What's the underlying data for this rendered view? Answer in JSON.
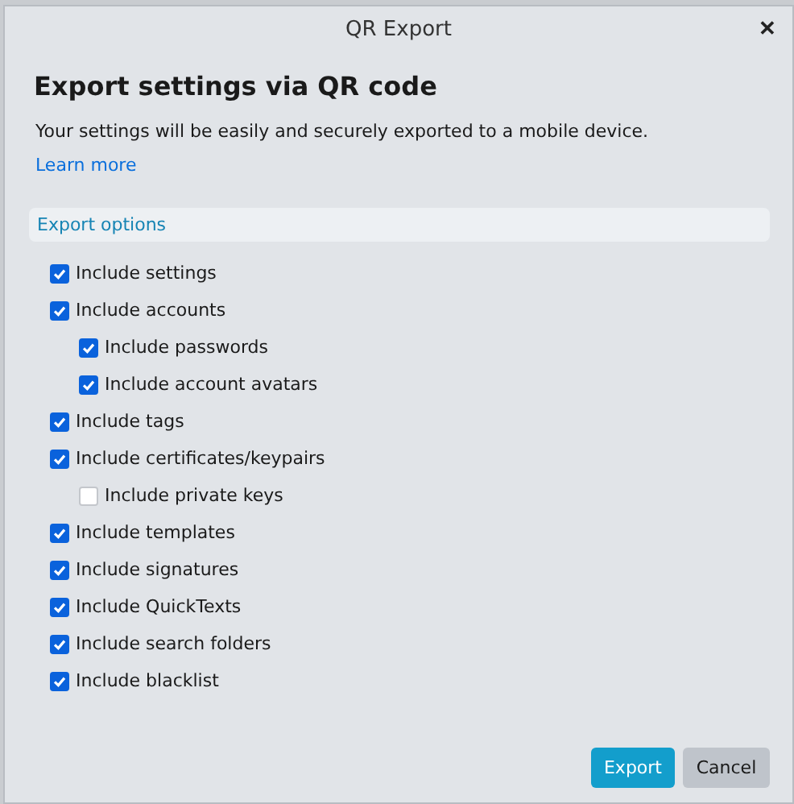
{
  "window": {
    "title": "QR Export",
    "close": "✕"
  },
  "heading": "Export settings via QR code",
  "description": "Your settings will be easily and securely exported to a mobile device.",
  "learn_more": "Learn more",
  "section_title": "Export options",
  "options": [
    {
      "label": "Include settings",
      "checked": true
    },
    {
      "label": "Include accounts",
      "checked": true,
      "children": [
        {
          "label": "Include passwords",
          "checked": true
        },
        {
          "label": "Include account avatars",
          "checked": true
        }
      ]
    },
    {
      "label": "Include tags",
      "checked": true
    },
    {
      "label": "Include certificates/keypairs",
      "checked": true,
      "children": [
        {
          "label": "Include private keys",
          "checked": false
        }
      ]
    },
    {
      "label": "Include templates",
      "checked": true
    },
    {
      "label": "Include signatures",
      "checked": true
    },
    {
      "label": "Include QuickTexts",
      "checked": true
    },
    {
      "label": "Include search folders",
      "checked": true
    },
    {
      "label": "Include blacklist",
      "checked": true
    }
  ],
  "buttons": [
    {
      "label": "Export",
      "kind": "primary"
    },
    {
      "label": "Cancel",
      "kind": "secondary"
    }
  ]
}
